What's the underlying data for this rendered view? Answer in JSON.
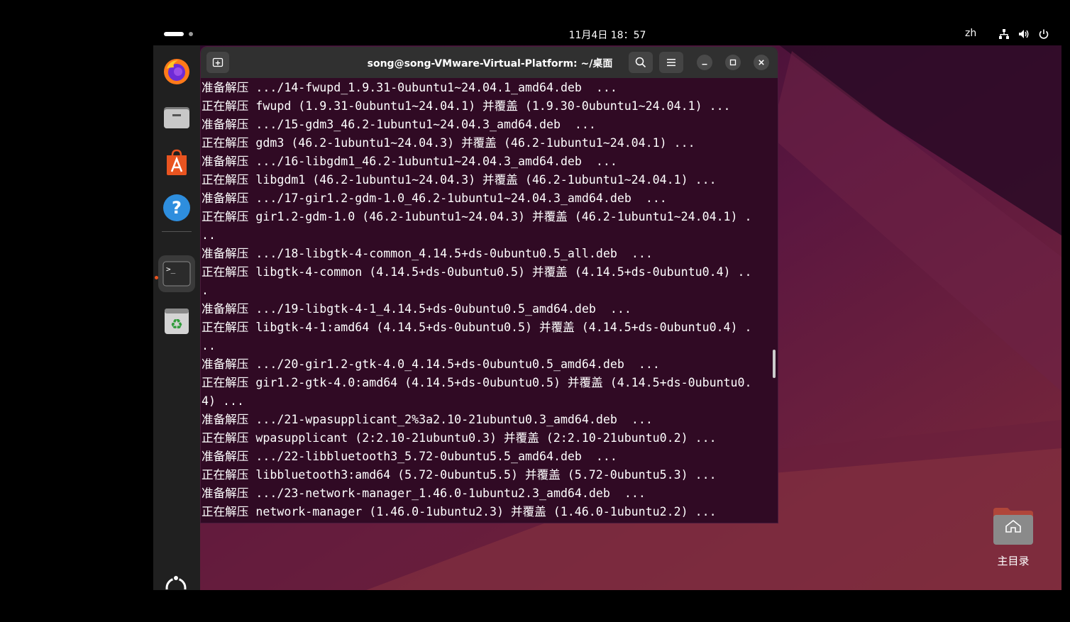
{
  "topbar": {
    "clock": "11月4日  18：57",
    "language": "zh",
    "icons": [
      "network-icon",
      "volume-icon",
      "power-icon"
    ]
  },
  "dock": {
    "apps": [
      "firefox",
      "files",
      "app-center",
      "help",
      "terminal",
      "trash"
    ],
    "show_apps_icon": "ubuntu-logo-icon"
  },
  "terminal": {
    "title": "song@song-VMware-Virtual-Platform: ~/桌面",
    "lines": [
      "准备解压 .../14-fwupd_1.9.31-0ubuntu1~24.04.1_amd64.deb  ...",
      "正在解压 fwupd (1.9.31-0ubuntu1~24.04.1) 并覆盖 (1.9.30-0ubuntu1~24.04.1) ...",
      "准备解压 .../15-gdm3_46.2-1ubuntu1~24.04.3_amd64.deb  ...",
      "正在解压 gdm3 (46.2-1ubuntu1~24.04.3) 并覆盖 (46.2-1ubuntu1~24.04.1) ...",
      "准备解压 .../16-libgdm1_46.2-1ubuntu1~24.04.3_amd64.deb  ...",
      "正在解压 libgdm1 (46.2-1ubuntu1~24.04.3) 并覆盖 (46.2-1ubuntu1~24.04.1) ...",
      "准备解压 .../17-gir1.2-gdm-1.0_46.2-1ubuntu1~24.04.3_amd64.deb  ...",
      "正在解压 gir1.2-gdm-1.0 (46.2-1ubuntu1~24.04.3) 并覆盖 (46.2-1ubuntu1~24.04.1) .",
      "..",
      "准备解压 .../18-libgtk-4-common_4.14.5+ds-0ubuntu0.5_all.deb  ...",
      "正在解压 libgtk-4-common (4.14.5+ds-0ubuntu0.5) 并覆盖 (4.14.5+ds-0ubuntu0.4) ..",
      ".",
      "准备解压 .../19-libgtk-4-1_4.14.5+ds-0ubuntu0.5_amd64.deb  ...",
      "正在解压 libgtk-4-1:amd64 (4.14.5+ds-0ubuntu0.5) 并覆盖 (4.14.5+ds-0ubuntu0.4) .",
      "..",
      "准备解压 .../20-gir1.2-gtk-4.0_4.14.5+ds-0ubuntu0.5_amd64.deb  ...",
      "正在解压 gir1.2-gtk-4.0:amd64 (4.14.5+ds-0ubuntu0.5) 并覆盖 (4.14.5+ds-0ubuntu0.",
      "4) ...",
      "准备解压 .../21-wpasupplicant_2%3a2.10-21ubuntu0.3_amd64.deb  ...",
      "正在解压 wpasupplicant (2:2.10-21ubuntu0.3) 并覆盖 (2:2.10-21ubuntu0.2) ...",
      "准备解压 .../22-libbluetooth3_5.72-0ubuntu5.5_amd64.deb  ...",
      "正在解压 libbluetooth3:amd64 (5.72-0ubuntu5.5) 并覆盖 (5.72-0ubuntu5.3) ...",
      "准备解压 .../23-network-manager_1.46.0-1ubuntu2.3_amd64.deb  ...",
      "正在解压 network-manager (1.46.0-1ubuntu2.3) 并覆盖 (1.46.0-1ubuntu2.2) ..."
    ]
  },
  "desktop": {
    "home_label": "主目录"
  }
}
